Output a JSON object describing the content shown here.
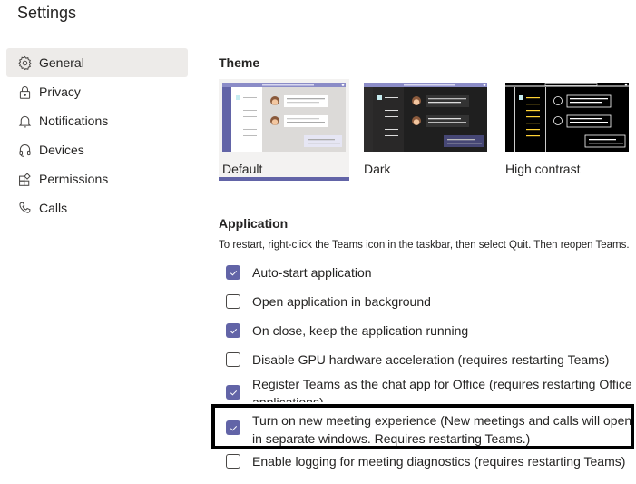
{
  "header": {
    "title": "Settings"
  },
  "sidebar": {
    "items": [
      {
        "label": "General",
        "icon": "gear-icon",
        "active": true
      },
      {
        "label": "Privacy",
        "icon": "lock-icon",
        "active": false
      },
      {
        "label": "Notifications",
        "icon": "bell-icon",
        "active": false
      },
      {
        "label": "Devices",
        "icon": "headset-icon",
        "active": false
      },
      {
        "label": "Permissions",
        "icon": "apps-icon",
        "active": false
      },
      {
        "label": "Calls",
        "icon": "phone-icon",
        "active": false
      }
    ]
  },
  "theme": {
    "title": "Theme",
    "options": [
      {
        "label": "Default",
        "selected": true
      },
      {
        "label": "Dark",
        "selected": false
      },
      {
        "label": "High contrast",
        "selected": false
      }
    ]
  },
  "application": {
    "title": "Application",
    "hint": "To restart, right-click the Teams icon in the taskbar, then select Quit. Then reopen Teams.",
    "options": [
      {
        "label": "Auto-start application",
        "checked": true
      },
      {
        "label": "Open application in background",
        "checked": false
      },
      {
        "label": "On close, keep the application running",
        "checked": true
      },
      {
        "label": "Disable GPU hardware acceleration (requires restarting Teams)",
        "checked": false
      },
      {
        "label": "Register Teams as the chat app for Office (requires restarting Office applications)",
        "checked": true
      },
      {
        "label": "Turn on new meeting experience (New meetings and calls will open in separate windows. Requires restarting Teams.)",
        "checked": true,
        "highlighted": true
      },
      {
        "label": "Enable logging for meeting diagnostics (requires restarting Teams)",
        "checked": false
      }
    ]
  },
  "colors": {
    "accent": "#6264a7",
    "selected_bg": "#edebe9"
  }
}
